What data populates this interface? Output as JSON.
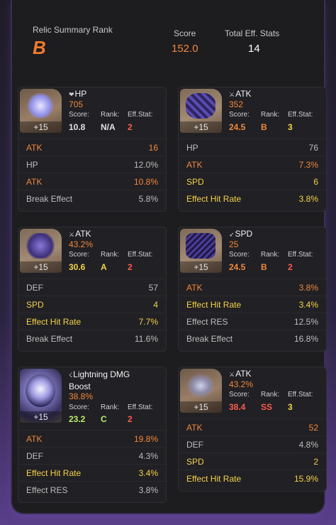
{
  "summary": {
    "rank_label": "Relic Summary Rank",
    "rank_value": "B",
    "score_label": "Score",
    "score_value": "152.0",
    "eff_label": "Total Eff. Stats",
    "eff_value": "14"
  },
  "labels": {
    "score": "Score:",
    "rank": "Rank:",
    "eff": "Eff.Stat:"
  },
  "relics": [
    {
      "level": "+15",
      "main_stat": "HP",
      "main_value": "705",
      "score": "10.8",
      "rank": "N/A",
      "eff": "2",
      "subs": [
        {
          "name": "ATK",
          "value": "16",
          "style": "hl"
        },
        {
          "name": "HP",
          "value": "12.0%",
          "style": "plain"
        },
        {
          "name": "ATK",
          "value": "10.8%",
          "style": "hl"
        },
        {
          "name": "Break Effect",
          "value": "5.8%",
          "style": "plain"
        }
      ]
    },
    {
      "level": "+15",
      "main_stat": "ATK",
      "main_value": "352",
      "score": "24.5",
      "rank": "B",
      "eff": "3",
      "subs": [
        {
          "name": "HP",
          "value": "76",
          "style": "plain"
        },
        {
          "name": "ATK",
          "value": "7.3%",
          "style": "hl"
        },
        {
          "name": "SPD",
          "value": "6",
          "style": "sp"
        },
        {
          "name": "Effect Hit Rate",
          "value": "3.8%",
          "style": "sp"
        }
      ]
    },
    {
      "level": "+15",
      "main_stat": "ATK",
      "main_value": "43.2%",
      "score": "30.6",
      "rank": "A",
      "eff": "2",
      "subs": [
        {
          "name": "DEF",
          "value": "57",
          "style": "plain"
        },
        {
          "name": "SPD",
          "value": "4",
          "style": "sp"
        },
        {
          "name": "Effect Hit Rate",
          "value": "7.7%",
          "style": "sp"
        },
        {
          "name": "Break Effect",
          "value": "11.6%",
          "style": "plain"
        }
      ]
    },
    {
      "level": "+15",
      "main_stat": "SPD",
      "main_value": "25",
      "score": "24.5",
      "rank": "B",
      "eff": "2",
      "subs": [
        {
          "name": "ATK",
          "value": "3.8%",
          "style": "hl"
        },
        {
          "name": "Effect Hit Rate",
          "value": "3.4%",
          "style": "sp"
        },
        {
          "name": "Effect RES",
          "value": "12.5%",
          "style": "plain"
        },
        {
          "name": "Break Effect",
          "value": "16.8%",
          "style": "plain"
        }
      ]
    },
    {
      "level": "+15",
      "main_stat": "Lightning DMG Boost",
      "main_value": "38.8%",
      "score": "23.2",
      "rank": "C",
      "eff": "2",
      "subs": [
        {
          "name": "ATK",
          "value": "19.8%",
          "style": "hl"
        },
        {
          "name": "DEF",
          "value": "4.3%",
          "style": "plain"
        },
        {
          "name": "Effect Hit Rate",
          "value": "3.4%",
          "style": "sp"
        },
        {
          "name": "Effect RES",
          "value": "3.8%",
          "style": "plain"
        }
      ]
    },
    {
      "level": "+15",
      "main_stat": "ATK",
      "main_value": "43.2%",
      "score": "38.4",
      "rank": "SS",
      "eff": "3",
      "subs": [
        {
          "name": "ATK",
          "value": "52",
          "style": "hl"
        },
        {
          "name": "DEF",
          "value": "4.8%",
          "style": "plain"
        },
        {
          "name": "SPD",
          "value": "2",
          "style": "sp"
        },
        {
          "name": "Effect Hit Rate",
          "value": "15.9%",
          "style": "sp"
        }
      ]
    }
  ]
}
